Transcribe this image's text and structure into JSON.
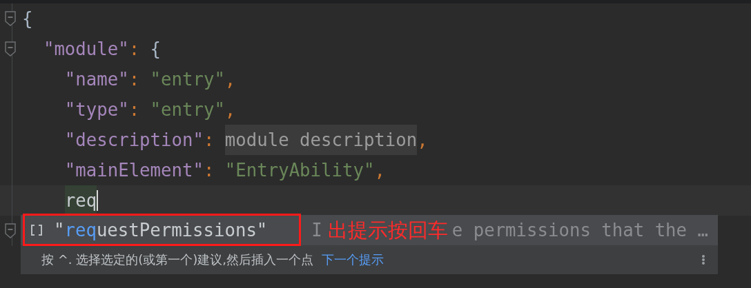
{
  "editor": {
    "lines": [
      {
        "fold": true,
        "tokens": [
          {
            "kind": "brace",
            "text": "{"
          }
        ]
      },
      {
        "fold": true,
        "tokens": [
          {
            "kind": "key",
            "text": "  \"module\""
          },
          {
            "kind": "colon",
            "text": ":"
          },
          {
            "kind": "brace",
            "text": " {"
          }
        ]
      },
      {
        "tokens": [
          {
            "kind": "key",
            "text": "    \"name\""
          },
          {
            "kind": "colon",
            "text": ":"
          },
          {
            "kind": "string",
            "text": " \"entry\""
          },
          {
            "kind": "comma",
            "text": ","
          }
        ]
      },
      {
        "tokens": [
          {
            "kind": "key",
            "text": "    \"type\""
          },
          {
            "kind": "colon",
            "text": ":"
          },
          {
            "kind": "string",
            "text": " \"entry\""
          },
          {
            "kind": "comma",
            "text": ","
          }
        ]
      },
      {
        "tokens": [
          {
            "kind": "key",
            "text": "    \"description\""
          },
          {
            "kind": "colon",
            "text": ": "
          },
          {
            "kind": "template",
            "text": "module description"
          },
          {
            "kind": "comma",
            "text": ","
          }
        ]
      },
      {
        "tokens": [
          {
            "kind": "key",
            "text": "    \"mainElement\""
          },
          {
            "kind": "colon",
            "text": ":"
          },
          {
            "kind": "string",
            "text": " \"EntryAbility\""
          },
          {
            "kind": "comma",
            "text": ","
          }
        ]
      },
      {
        "current": true,
        "tokens": [
          {
            "kind": "typed",
            "text": "    req"
          }
        ]
      },
      {
        "fold": true
      }
    ]
  },
  "completion_popup": {
    "items": [
      {
        "label": {
          "before": "\"",
          "match": "req",
          "after": "uestPermissions\""
        },
        "description_start": "I",
        "description_end": "e permissions that the …",
        "selected": true
      }
    ],
    "hint": "按 ^. 选择选定的(或第一个)建议,然后插入一个点",
    "hint_link": "下一个提示"
  },
  "annotation": {
    "text": "出提示按回车"
  }
}
